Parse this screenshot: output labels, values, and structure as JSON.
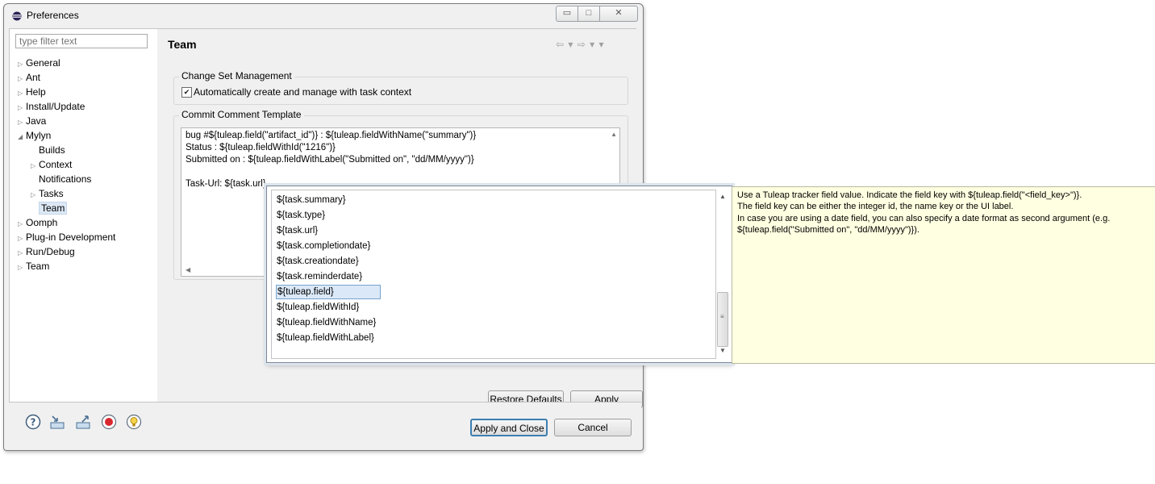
{
  "window": {
    "title": "Preferences",
    "controls": {
      "minimize": "▭",
      "maximize": "□",
      "close": "✕"
    }
  },
  "filter": {
    "placeholder": "type filter text"
  },
  "tree": [
    {
      "label": "General",
      "level": 0,
      "expanded": false
    },
    {
      "label": "Ant",
      "level": 0,
      "expanded": false
    },
    {
      "label": "Help",
      "level": 0,
      "expanded": false
    },
    {
      "label": "Install/Update",
      "level": 0,
      "expanded": false
    },
    {
      "label": "Java",
      "level": 0,
      "expanded": false
    },
    {
      "label": "Mylyn",
      "level": 0,
      "expanded": true
    },
    {
      "label": "Builds",
      "level": 1,
      "expanded": null
    },
    {
      "label": "Context",
      "level": 1,
      "expanded": false
    },
    {
      "label": "Notifications",
      "level": 1,
      "expanded": null
    },
    {
      "label": "Tasks",
      "level": 1,
      "expanded": false
    },
    {
      "label": "Team",
      "level": 1,
      "expanded": null,
      "selected": true
    },
    {
      "label": "Oomph",
      "level": 0,
      "expanded": false
    },
    {
      "label": "Plug-in Development",
      "level": 0,
      "expanded": false
    },
    {
      "label": "Run/Debug",
      "level": 0,
      "expanded": false
    },
    {
      "label": "Team",
      "level": 0,
      "expanded": false
    }
  ],
  "page": {
    "title": "Team",
    "nav": "⇦ ▾ ⇨ ▾ ▾"
  },
  "changeset": {
    "label": "Change Set Management",
    "checkbox_label": "Automatically create and manage with task context",
    "checked": true
  },
  "commit": {
    "label": "Commit Comment Template",
    "lines": [
      "bug #${tuleap.field(\"artifact_id\")} : ${tuleap.fieldWithName(\"summary\")}",
      "Status : ${tuleap.fieldWithId(\"1216\")}",
      "Submitted on : ${tuleap.fieldWithLabel(\"Submitted on\", \"dd/MM/yyyy\")}",
      "",
      "Task-Url: ${task.url}"
    ]
  },
  "buttons": {
    "restore": "Restore Defaults",
    "apply": "Apply",
    "apply_close": "Apply and Close",
    "cancel": "Cancel"
  },
  "assist": {
    "items": [
      "${task.summary}",
      "${task.type}",
      "${task.url}",
      "${task.completiondate}",
      "${task.creationdate}",
      "${task.reminderdate}",
      "${tuleap.field}",
      "${tuleap.fieldWithId}",
      "${tuleap.fieldWithName}",
      "${tuleap.fieldWithLabel}"
    ],
    "selected_index": 6
  },
  "info": {
    "lines": [
      "Use a Tuleap tracker field value. Indicate the field key with ${tuleap.field(\"<field_key>\")}.",
      "The field key can be either the integer id, the name key or the UI label.",
      "In case you are using a date field, you can also specify a date format as second argument (e.g.",
      "${tuleap.field(\"Submitted on\", \"dd/MM/yyyy\")})."
    ]
  },
  "bottom_icons": [
    "help-icon",
    "import-icon",
    "export-icon",
    "record-icon",
    "tip-icon"
  ]
}
